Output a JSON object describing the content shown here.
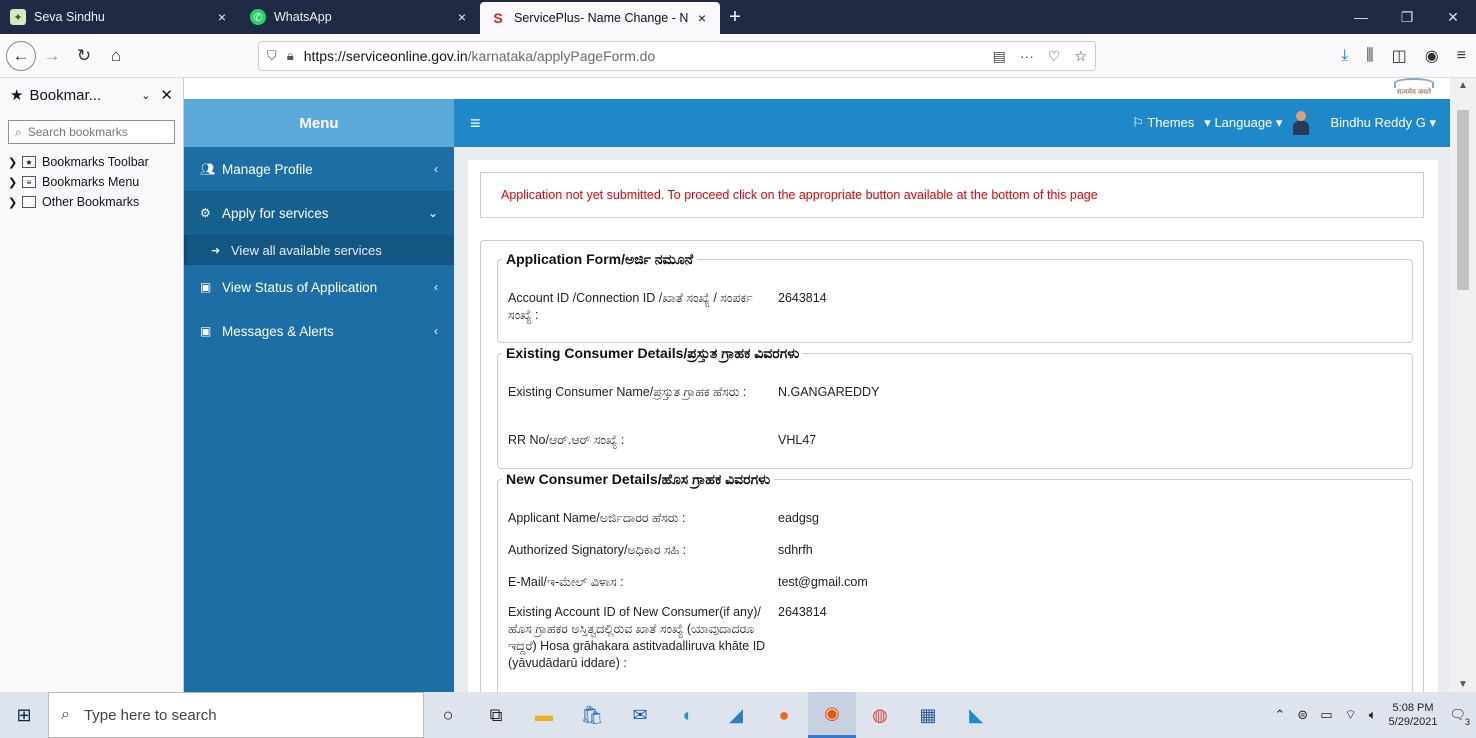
{
  "browser": {
    "tabs": [
      {
        "title": "Seva Sindhu",
        "icon": "seva-sindhu-favicon"
      },
      {
        "title": "WhatsApp",
        "icon": "whatsapp-favicon"
      },
      {
        "title": "ServicePlus- Name Change - N",
        "icon": "serviceplus-favicon"
      }
    ],
    "url_host": "https://serviceonline.gov.in",
    "url_path": "/karnataka/applyPageForm.do"
  },
  "bookmarks": {
    "title": "Bookmar...",
    "search_placeholder": "Search bookmarks",
    "items": [
      "Bookmarks Toolbar",
      "Bookmarks Menu",
      "Other Bookmarks"
    ]
  },
  "app": {
    "emblem_text": "सत्यमेव जयते",
    "menu_title": "Menu",
    "header": {
      "themes": "Themes",
      "language": "Language",
      "user": "Bindhu Reddy G"
    },
    "nav": {
      "items": [
        "Manage Profile",
        "Apply for services",
        "View Status of Application",
        "Messages & Alerts"
      ],
      "sub_item": "View all available services"
    },
    "alert": "Application not yet submitted. To proceed click on the appropriate button available at the bottom of this page",
    "sections": [
      {
        "title": "Application Form/ಅರ್ಜಿ ನಮೂನೆ",
        "rows": [
          {
            "label": "Account ID /Connection ID /ಖಾತೆ ಸಂಖ್ಯೆ / ಸಂಪರ್ಕ ಸಂಖ್ಯೆ :",
            "value": "2643814"
          }
        ]
      },
      {
        "title": "Existing Consumer Details/ಪ್ರಸ್ತುತ ಗ್ರಾಹಕ ವಿವರಗಳು",
        "rows": [
          {
            "label": "Existing Consumer Name/ಪ್ರಸ್ತುತ ಗ್ರಾಹಕ ಹೆಸರು :",
            "value": "N.GANGAREDDY"
          },
          {
            "label": "RR No/ಆರ್.ಆರ್ ಸಂಖ್ಯೆ :",
            "value": "VHL47"
          }
        ]
      },
      {
        "title": "New Consumer Details/ಹೊಸ ಗ್ರಾಹಕ ವಿವರಗಳು",
        "rows": [
          {
            "label": "Applicant Name/ಅರ್ಜಿದಾರರ ಹೆಸರು :",
            "value": "eadgsg"
          },
          {
            "label": "Authorized Signatory/ಅಧಿಕಾರ ಸಹಿ :",
            "value": "sdhrfh"
          },
          {
            "label": "E-Mail/ಇ-ಮೇಲ್ ವಿಳಾಸ :",
            "value": "test@gmail.com"
          },
          {
            "label": "Existing Account ID of New Consumer(if any)/ಹೊಸ ಗ್ರಾಹಕರ ಅಸ್ತಿತ್ವದಲ್ಲಿರುವ ಖಾತೆ ಸಂಖ್ಯೆ (ಯಾವುದಾದರೂ ಇದ್ದರೆ) Hosa grāhakara astitvadalliruva khāte ID (yāvudādarū iddare) :",
            "value": "2643814"
          }
        ]
      }
    ]
  },
  "taskbar": {
    "search_placeholder": "Type here to search",
    "time": "5:08 PM",
    "date": "5/29/2021",
    "notifications": "3"
  }
}
